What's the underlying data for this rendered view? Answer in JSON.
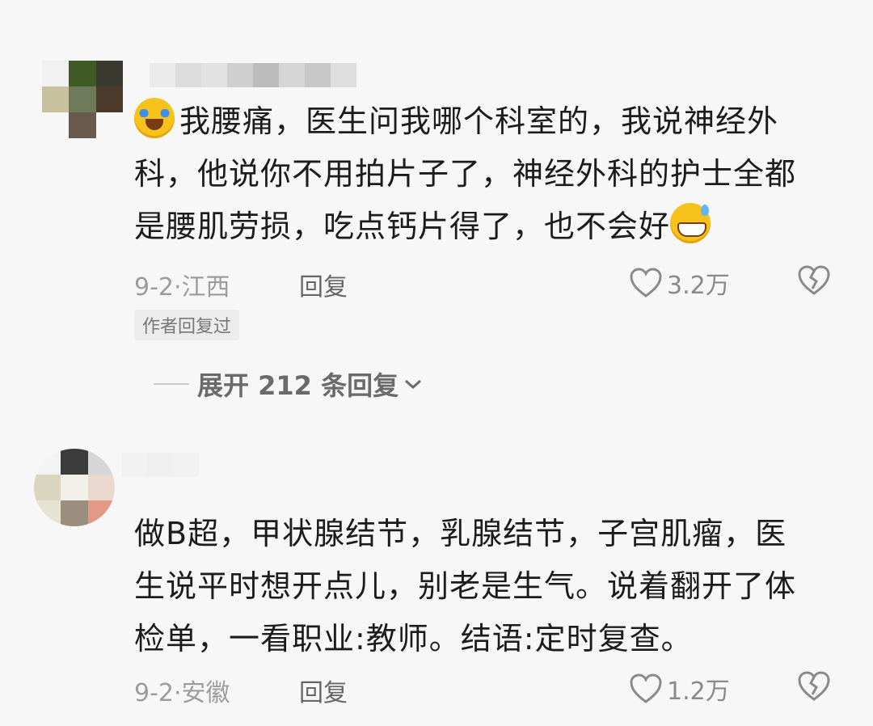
{
  "comments": [
    {
      "text": [
        "我腰痛，医生问我哪个科室的，我说神经外",
        "科，他说你不用拍片子了，神经外科的护士全都",
        "是腰肌劳损，吃点钙片得了，也不会好"
      ],
      "date_location": "9-2·江西",
      "reply_label": "回复",
      "likes": "3.2万",
      "author_badge": "作者回复过",
      "expand_label": "展开 212 条回复"
    },
    {
      "text": [
        "做B超，甲状腺结节，乳腺结节，子宫肌瘤，医",
        "生说平时想开点儿，别老是生气。说着翻开了体",
        "检单，一看职业:教师。结语:定时复查。"
      ],
      "date_location": "9-2·安徽",
      "reply_label": "回复",
      "likes": "1.2万"
    }
  ],
  "icons": {
    "emoji_start": "loudly-crying-emoji",
    "emoji_end": "grinning-sweat-emoji",
    "like": "heart-outline-icon",
    "dislike": "broken-heart-icon",
    "expand": "chevron-down-icon"
  },
  "colors": {
    "background": "#f7f7f7",
    "text": "#1c1c1c",
    "meta": "#9c9c9c"
  }
}
